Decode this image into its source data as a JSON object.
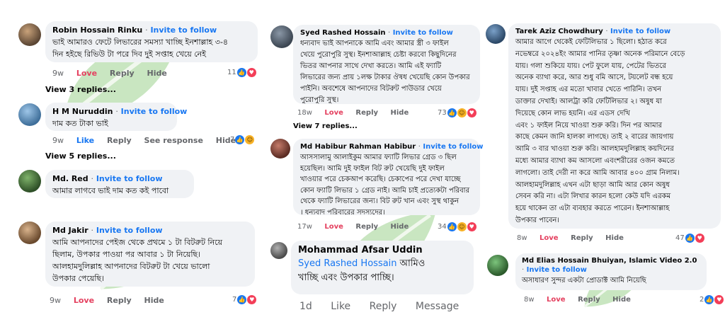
{
  "invite": "Invite to follow",
  "dot": "·",
  "col1": {
    "c1": {
      "name": "Robin Hossain Rinku",
      "lines": [
        "ভাই আমারও ফেটে লিভারের সমস্যা খাচ্ছি ইনশাল্লাহ ৩-৪",
        "দিন হইছে রিভিউ টা পরে দিব দুই সপ্তাহ খেয়ে নেই"
      ],
      "time": "9w",
      "love": "Love",
      "reply": "Reply",
      "hide": "Hide",
      "count": "11",
      "replies": "View 3 replies..."
    },
    "c2": {
      "name": "H M Nuruddin",
      "lines": [
        "দাম কত টাকা ভাই"
      ],
      "time": "9w",
      "like": "Like",
      "reply": "Reply",
      "see": "See response",
      "hide": "Hide",
      "count": "7",
      "replies": "View 5 replies..."
    },
    "c3": {
      "name": "Md. Red",
      "lines": [
        "আমার লাগবে ভাই  দাম কত কই পাবো"
      ]
    },
    "c4": {
      "name": "Md Jakir",
      "lines": [
        "আমি আপনাদের পেইজ থেকে প্রথমে ১ টা বিটরুট নিয়ে",
        "ছিলাম, উপকার পাওয়া পর আবার ১  টা নিয়েছি।",
        "আলহামদুলিল্লাহ আপনাদের বিটরুট টা খেয়ে ভালো",
        "উপকার পেয়েছি।"
      ],
      "time": "9w",
      "love": "Love",
      "reply": "Reply",
      "hide": "Hide",
      "count": "7"
    }
  },
  "col2": {
    "c1": {
      "name": "Syed Rashed Hossain",
      "lines": [
        "ধন্যবাদ ভাই আপনাকে আমি এবং আমার স্ত্রী ৩ ফাইল",
        "খেয়ে পুরোপুরি সুস্থ। ইনশাআল্লাহ চেষ্টা করবো কিছুদিনের",
        "ভিতর আপনার সাথে দেখা করতে।  আমি এই ফ্যাটি",
        "লিভারের জন্য প্রায় ১লক্ষ টাকার ঔষধ খেয়েছি কোন উপকার",
        "পাইনি। অবশেষে আপনাদের বিটরুট পাউডার খেয়ে",
        "পুরোপুরি সুস্থ।"
      ],
      "time": "18w",
      "love": "Love",
      "reply": "Reply",
      "hide": "Hide",
      "count": "73",
      "replies": "View 7 replies..."
    },
    "c2": {
      "name": "Md Habibur Rahman Habibur",
      "lines": [
        "আসসালামু আলাইকুম আমার ফ্যাটি লিভার গ্রেড ৩ ছিল",
        "হয়েছিল। আমি দুই ফাইল বিট রুট খেয়েছি দুই ফাইল",
        "খাওয়ার পরে চেকআপ করেছি। চেকাপের পরে দেখা যাচ্ছে",
        "কোন ফ্যাটি লিভার ১ গ্রেড নাই। আমি চাই প্রত্যেকটা পরিবার",
        "থেকে ফ্যাটি  লিভারের জন্য। বিট রুট খান এবং সুস্থ থাকুন",
        "। ধন্যবাদ      পরিবারের সদস্যদের।"
      ],
      "time": "17w",
      "love": "Love",
      "reply": "Reply",
      "hide": "Hide",
      "count": "34"
    },
    "c3": {
      "name": "Mohammad Afsar Uddin",
      "mention": "Syed Rashed Hossain",
      "line1_rest": " আমিও",
      "line2": "খাচ্ছি এবং উপকার পাচ্ছি।",
      "time": "1d",
      "like": "Like",
      "reply": "Reply",
      "message": "Message"
    }
  },
  "col3": {
    "c1": {
      "name": "Tarek Aziz Chowdhury",
      "lines": [
        "আমার আগে থেকেই ফেটিলিভার ১ ছিলো।  হঠাত করে",
        "নভেম্বরে ২০২৪ইং আমার পানির তৃষ্ণা অনেক পরিমানে বেড়ে",
        "যায়। গলা শুকিয়ে যায়। পেট ফুলে যায়, পেটের ভিতরে",
        "অনেক ব্যাথা করে, আর শুধু বমি আসে,  টয়লেট বন্ধ  হয়ে",
        "যায়। দুই সপ্তাহ এর মতো খাবার খেতে পারিনি। তখন",
        "ডাক্তার দেখাই। আলট্রা করি ফেটিলিভার ২। অষুধ যা",
        "দিয়েছে কোন লাভ হয়নি।                   এর এডস দেখি",
        "এবং ১ ফাইল নিয়ে খাওয়া শুরু করি।    দিন পর আমার",
        "কাছে কেমন জানি হালকা লাগছে। তাই ২ বারের জায়গায়",
        "আমি ৩ বার খাওয়া শুরু করি। আলহামদুলিল্লাহ কয়দিনের",
        "মধ্যে আমার ব্যাথা কম আসলো এবংশরীরের ওজন কমতে",
        "লাগলো। তাই দেরী না করে আমি আবার ৪০০ গ্রাম নিলাম।",
        "আলহামদুলিল্লাহ  এখন এটা ছাড়া আমি আর কোন অষুধ",
        "সেবন করি না। এটা লিখার কারন হলো কেউ যদি এরকম",
        "হয়ে থাকেন তা এটা ব্যবহার করতে পারেন। ইনশাআল্লাহ",
        "উপকার পাবেন।"
      ],
      "time": "8w",
      "love": "Love",
      "reply": "Reply",
      "hide": "Hide",
      "count": "47"
    },
    "c2": {
      "name": "Md Elias Hossain Bhuiyan, Islamic  Video 2.0",
      "lines": [
        "অসাধারণ সুন্দর একটা প্রোডাক্ট আমি নিয়েছি"
      ],
      "time": "8w",
      "love": "Love",
      "reply": "Reply",
      "hide": "Hide",
      "count": "2"
    }
  }
}
